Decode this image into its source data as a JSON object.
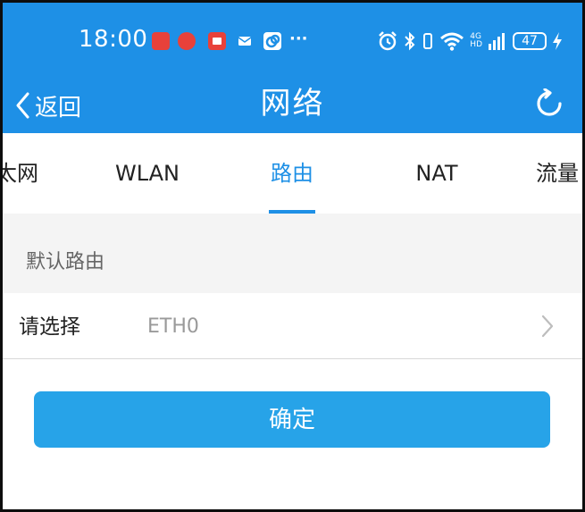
{
  "status_bar": {
    "time": "18:00",
    "overflow": "···",
    "network_type": "4G",
    "network_sub": "HD",
    "battery": "47"
  },
  "nav": {
    "back_label": "返回",
    "title": "网络"
  },
  "tabs": [
    {
      "label": "以太网"
    },
    {
      "label": "WLAN"
    },
    {
      "label": "路由"
    },
    {
      "label": "NAT"
    },
    {
      "label": "流量"
    }
  ],
  "active_tab": 2,
  "section": {
    "title": "默认路由"
  },
  "route_select": {
    "label": "请选择",
    "value": "ETH0"
  },
  "confirm_label": "确定",
  "colors": {
    "header": "#1e90e6",
    "accent": "#1e90e6",
    "button": "#27a3e8",
    "section_bg": "#f4f4f4"
  }
}
